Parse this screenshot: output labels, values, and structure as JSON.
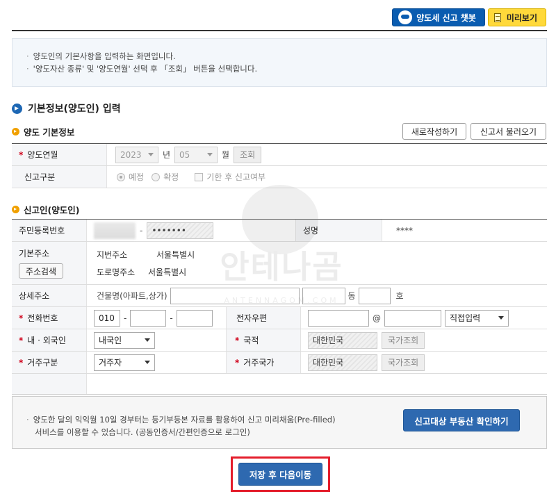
{
  "toolbar": {
    "chatbot_label": "양도세 신고 챗봇",
    "preview_label": "미리보기"
  },
  "guide": {
    "lines": [
      "양도인의 기본사항을 입력하는 화면입니다.",
      "'양도자산 종류' 및 '양도연월' 선택 후 「조회」 버튼을 선택합니다."
    ]
  },
  "section": {
    "title": "기본정보(양도인) 입력"
  },
  "transfer": {
    "title": "양도 기본정보",
    "new_button": "새로작성하기",
    "load_button": "신고서 불러오기",
    "year_label": "양도연월",
    "year_value": "2023",
    "year_unit": "년",
    "month_value": "05",
    "month_unit": "월",
    "query_button": "조회",
    "type_label": "신고구분",
    "radio_scheduled": "예정",
    "radio_final": "확정",
    "after_deadline_label": "기한 후 신고여부"
  },
  "reporter": {
    "title": "신고인(양도인)",
    "rrn_label": "주민등록번호",
    "rrn_dash": "-",
    "rrn_back": "•••••••",
    "name_label": "성명",
    "name_value": "****",
    "addr_label": "기본주소",
    "addr_search_button": "주소검색",
    "jibun_label": "지번주소",
    "jibun_value": "서울특별시",
    "road_label": "도로명주소",
    "road_value": "서울특별시",
    "detail_label": "상세주소",
    "building_label": "건물명(아파트,상가)",
    "dong_unit": "동",
    "ho_unit": "호",
    "phone_label": "전화번호",
    "phone_prefix": "010",
    "phone_dash": "-",
    "email_label": "전자우편",
    "email_at": "@",
    "email_domain_select": "직접입력",
    "nationality_type_label": "내 · 외국인",
    "nationality_type_value": "내국인",
    "country_label": "국적",
    "country_value": "대한민국",
    "country_search_button": "국가조회",
    "residence_type_label": "거주구분",
    "residence_type_value": "거주자",
    "residence_country_label": "거주국가",
    "residence_country_value": "대한민국",
    "residence_search_button": "국가조회"
  },
  "notice": {
    "line1": "양도한 달의 익익월 10일 경부터는 등기부등본 자료를 활용하여 신고 미리채움(Pre-filled)",
    "line2": "서비스를 이용할 수 있습니다. (공동인증서/간편인증으로 로그인)",
    "check_button": "신고대상 부동산 확인하기"
  },
  "footer": {
    "save_button": "저장 후 다음이동"
  },
  "watermark": {
    "text": "안테나곰",
    "sub": "ANTENNAGOM.COM"
  }
}
